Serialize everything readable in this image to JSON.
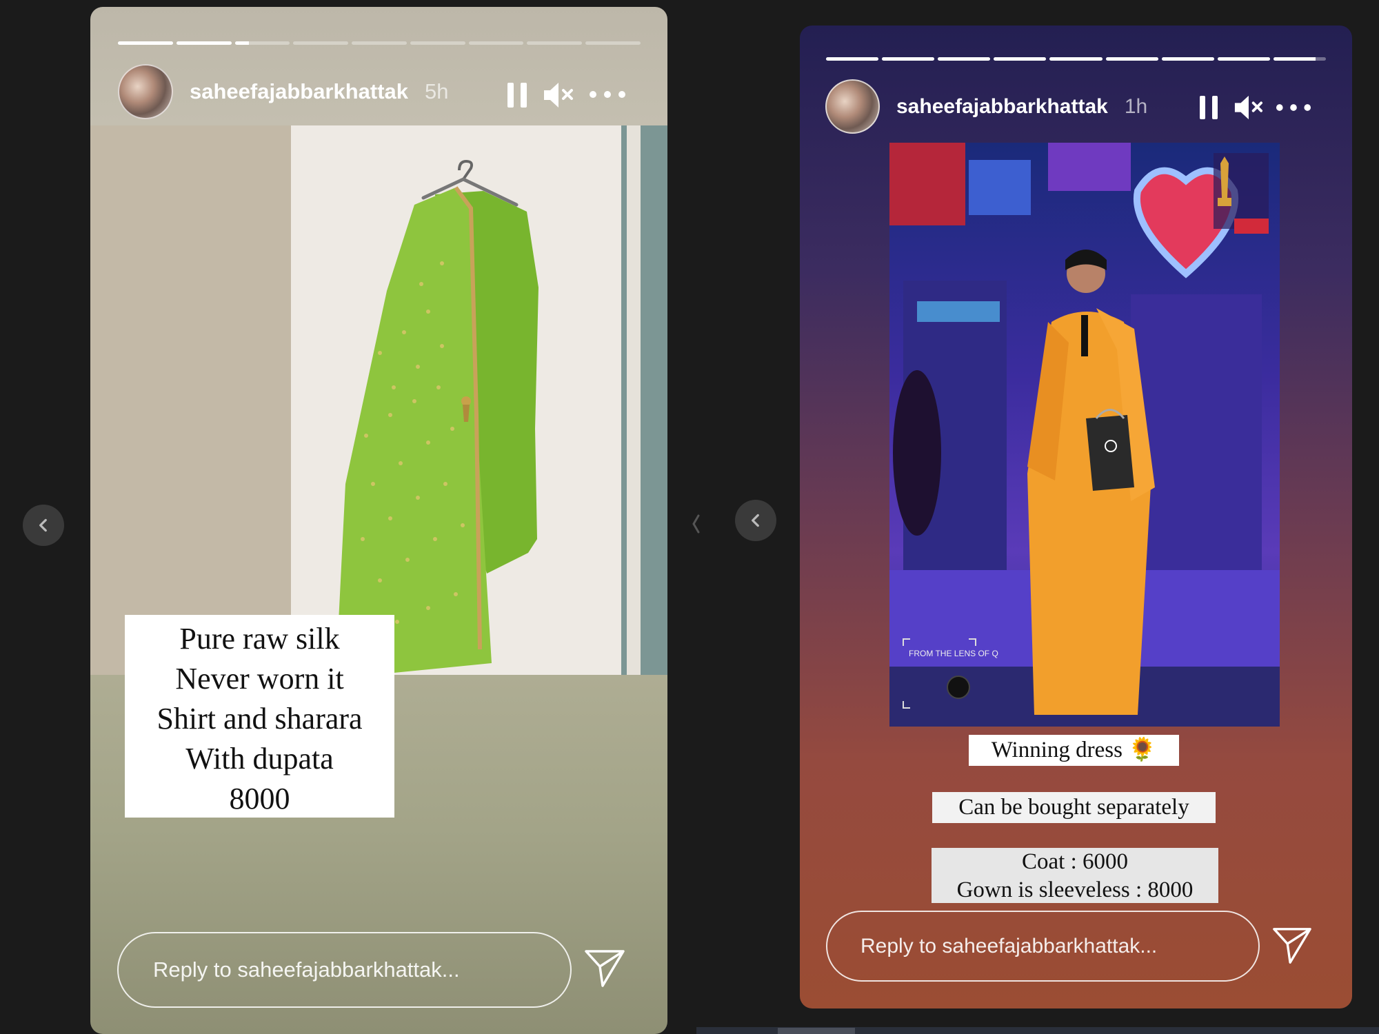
{
  "story1": {
    "username": "saheefajabbarkhattak",
    "time_ago": "5h",
    "progress_fill": [
      1,
      1,
      0.25,
      0,
      0,
      0,
      0,
      0,
      0
    ],
    "caption_lines": [
      "Pure raw silk",
      "Never worn it",
      "Shirt and sharara",
      "With dupata",
      "8000"
    ],
    "reply_placeholder": "Reply to saheefajabbarkhattak..."
  },
  "story2": {
    "username": "saheefajabbarkhattak",
    "time_ago": "1h",
    "progress_fill": [
      1,
      1,
      1,
      1,
      1,
      1,
      1,
      1,
      0.8
    ],
    "photo_watermark": "FROM THE LENS OF Q",
    "caption_winning": "Winning dress 🌻",
    "caption_separately": "Can be bought separately",
    "caption_prices": [
      "Coat : 6000",
      "Gown is sleeveless : 8000"
    ],
    "reply_placeholder": "Reply to saheefajabbarkhattak..."
  },
  "icons": {
    "pause": "pause-icon",
    "mute": "muted-speaker-icon",
    "more": "more-options-icon",
    "send": "paper-plane-icon",
    "prev": "chevron-left-icon"
  }
}
